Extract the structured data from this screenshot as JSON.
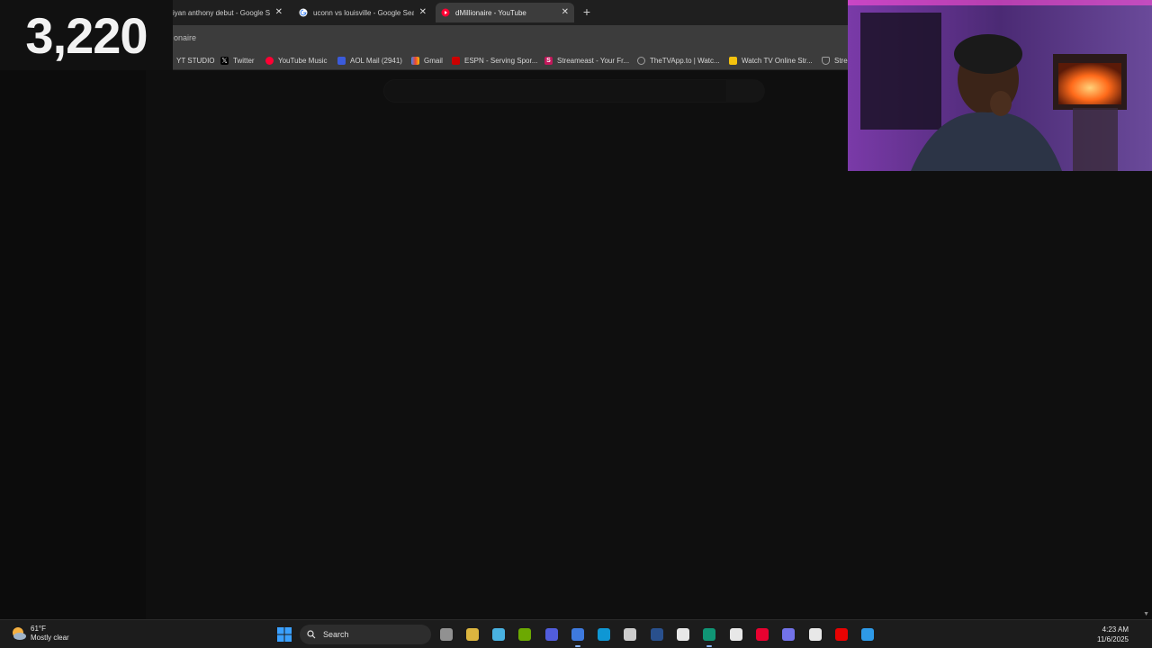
{
  "browser": {
    "tabs": [
      {
        "title": "iyan anthony debut - Google S",
        "active": false
      },
      {
        "title": "uconn vs louisville - Google Sea",
        "active": false
      },
      {
        "title": "dMillionaire - YouTube",
        "active": true
      }
    ],
    "new_tab_label": "+",
    "address_text": "onaire",
    "bookmarks": [
      {
        "label": "YT STUDIO",
        "icon": "youtube-studio-icon",
        "color": "#ff0000"
      },
      {
        "label": "Twitter",
        "icon": "x-icon",
        "color": "#000000"
      },
      {
        "label": "YouTube Music",
        "icon": "youtube-music-icon",
        "color": "#ff0033"
      },
      {
        "label": "AOL Mail (2941)",
        "icon": "aol-icon",
        "color": "#3b5bdb"
      },
      {
        "label": "Gmail",
        "icon": "gmail-icon",
        "color": "#ea4335"
      },
      {
        "label": "ESPN - Serving Spor...",
        "icon": "espn-icon",
        "color": "#cc0000"
      },
      {
        "label": "Streameast - Your Fr...",
        "icon": "streameast-icon",
        "color": "#c2185b"
      },
      {
        "label": "TheTVApp.to | Watc...",
        "icon": "globe-icon",
        "color": "#9e9e9e"
      },
      {
        "label": "Watch TV Online Str...",
        "icon": "tv-icon",
        "color": "#f4c20d"
      },
      {
        "label": "Strea",
        "icon": "shield-icon",
        "color": "#9e9e9e"
      }
    ]
  },
  "overlay": {
    "counter": "3,220"
  },
  "taskbar": {
    "weather": {
      "temp": "61°F",
      "condition": "Mostly clear"
    },
    "search_label": "Search",
    "apps": [
      {
        "name": "task-view-icon",
        "color": "#9e9e9e"
      },
      {
        "name": "file-explorer-icon",
        "color": "#f2c744"
      },
      {
        "name": "notepad-icon",
        "color": "#4fc3f7"
      },
      {
        "name": "nvidia-icon",
        "color": "#76b900"
      },
      {
        "name": "discord-icon",
        "color": "#5865f2"
      },
      {
        "name": "chrome-icon",
        "color": "#4285f4"
      },
      {
        "name": "edge-icon",
        "color": "#0ea5e9"
      },
      {
        "name": "app-icon",
        "color": "#e0e0e0"
      },
      {
        "name": "word-icon",
        "color": "#2b579a"
      },
      {
        "name": "capcut-icon",
        "color": "#ffffff"
      },
      {
        "name": "chatgpt-icon",
        "color": "#10a37f"
      },
      {
        "name": "roblox-icon",
        "color": "#ffffff"
      },
      {
        "name": "youtube-music-icon",
        "color": "#ff0033"
      },
      {
        "name": "app-icon",
        "color": "#7c7cff"
      },
      {
        "name": "x-icon",
        "color": "#ffffff"
      },
      {
        "name": "youtube-icon",
        "color": "#ff0000"
      },
      {
        "name": "photoshop-icon",
        "color": "#31a8ff"
      }
    ],
    "time": "4:23 AM",
    "date": "11/6/2025"
  }
}
